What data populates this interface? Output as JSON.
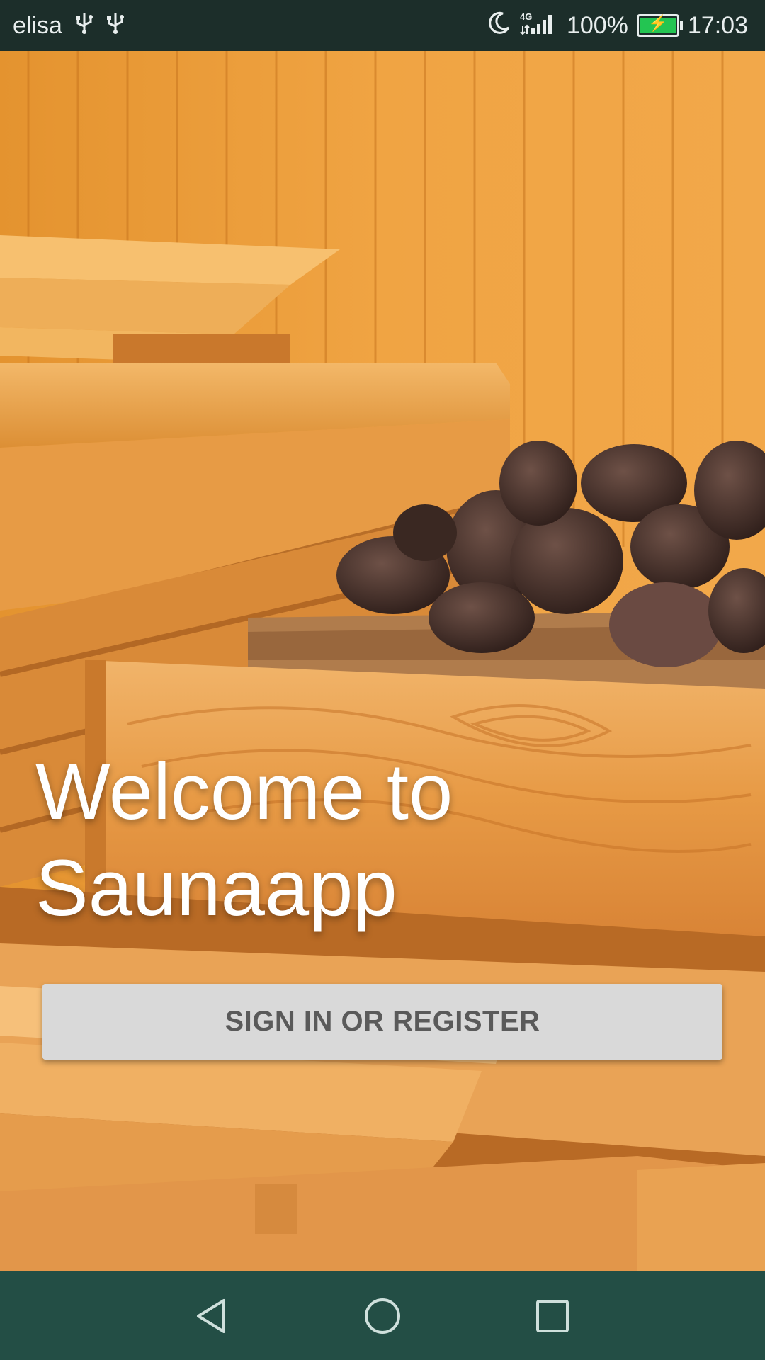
{
  "status_bar": {
    "carrier": "elisa",
    "usb_icons": [
      "usb-icon",
      "usb-icon"
    ],
    "network": "4G",
    "battery_percent": "100%",
    "time": "17:03",
    "icons": [
      "moon-icon",
      "signal-icon",
      "battery-icon"
    ]
  },
  "main": {
    "welcome_line1": "Welcome to",
    "welcome_line2": "Saunaapp",
    "cta_label": "SIGN IN OR REGISTER"
  },
  "nav_bar": {
    "icons": [
      "back-icon",
      "home-icon",
      "recents-icon"
    ]
  },
  "colors": {
    "status_bar_bg": "#1c2e2a",
    "nav_bar_bg": "#234e45",
    "button_bg": "#d9d9d9",
    "button_text": "#5a5a5a",
    "battery_green": "#23c552"
  }
}
